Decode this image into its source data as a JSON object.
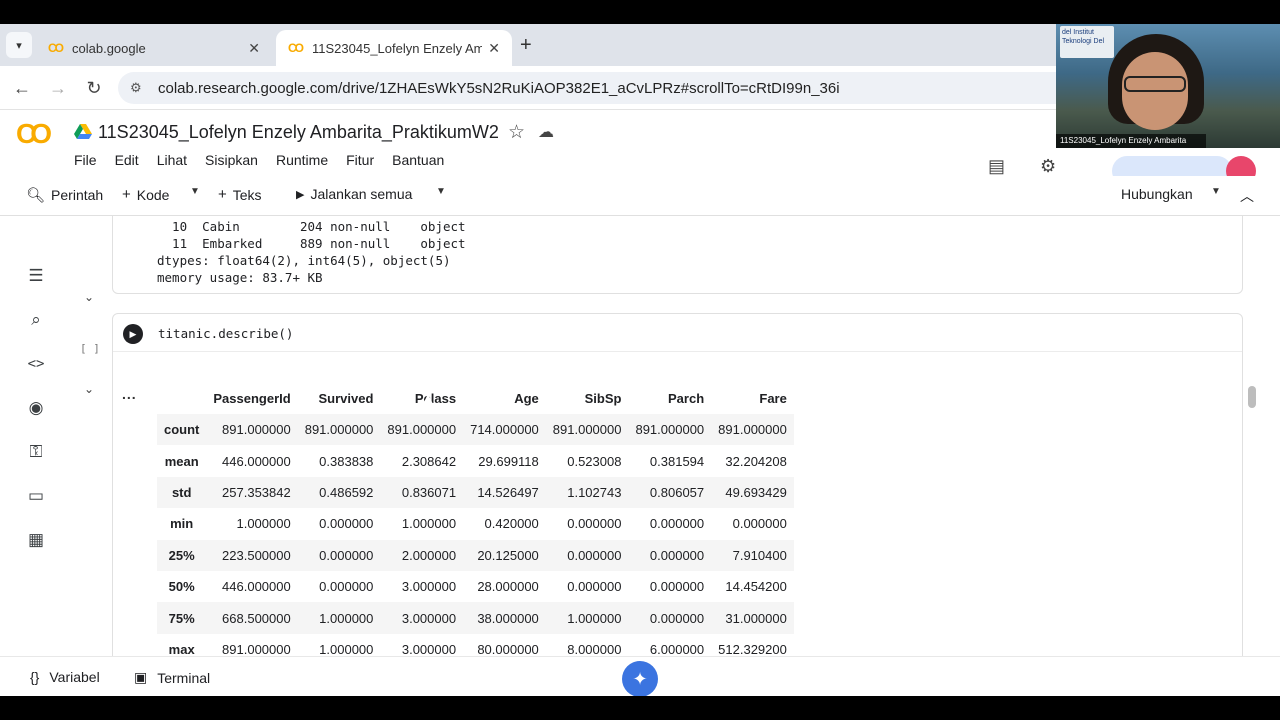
{
  "browser": {
    "tabs": [
      {
        "title": "colab.google",
        "logo": "CO"
      },
      {
        "title": "11S23045_Lofelyn Enzely Amba",
        "logo": "CO"
      }
    ],
    "url": "colab.research.google.com/drive/1ZHAEsWkY5sN2RuKiAOP382E1_aCvLPRz#scrollTo=cRtDI99n_36i"
  },
  "colab": {
    "logo": "CO",
    "notebook_title": "11S23045_Lofelyn Enzely Ambarita_PraktikumW2",
    "menu": [
      "File",
      "Edit",
      "Lihat",
      "Sisipkan",
      "Runtime",
      "Fitur",
      "Bantuan"
    ],
    "toolbar": {
      "command": "Perintah",
      "code": "Kode",
      "text": "Teks",
      "run_all": "Jalankan semua",
      "connect": "Hubungkan"
    }
  },
  "webcam": {
    "caption": "11S23045_Lofelyn Enzely Ambarita",
    "badge": "del Institut Teknologi Del"
  },
  "prev_output": {
    "lines": [
      "  10  Cabin        204 non-null    object",
      "  11  Embarked     889 non-null    object",
      "dtypes: float64(2), int64(5), object(5)",
      "memory usage: 83.7+ KB"
    ]
  },
  "cell": {
    "brackets": "[ ]",
    "code": "titanic.describe()",
    "output_marker": "..."
  },
  "describe_table": {
    "columns": [
      "",
      "PassengerId",
      "Survived",
      "Pclass",
      "Age",
      "SibSp",
      "Parch",
      "Fare"
    ],
    "rows": [
      [
        "count",
        "891.000000",
        "891.000000",
        "891.000000",
        "714.000000",
        "891.000000",
        "891.000000",
        "891.000000"
      ],
      [
        "mean",
        "446.000000",
        "0.383838",
        "2.308642",
        "29.699118",
        "0.523008",
        "0.381594",
        "32.204208"
      ],
      [
        "std",
        "257.353842",
        "0.486592",
        "0.836071",
        "14.526497",
        "1.102743",
        "0.806057",
        "49.693429"
      ],
      [
        "min",
        "1.000000",
        "0.000000",
        "1.000000",
        "0.420000",
        "0.000000",
        "0.000000",
        "0.000000"
      ],
      [
        "25%",
        "223.500000",
        "0.000000",
        "2.000000",
        "20.125000",
        "0.000000",
        "0.000000",
        "7.910400"
      ],
      [
        "50%",
        "446.000000",
        "0.000000",
        "3.000000",
        "28.000000",
        "0.000000",
        "0.000000",
        "14.454200"
      ],
      [
        "75%",
        "668.500000",
        "1.000000",
        "3.000000",
        "38.000000",
        "1.000000",
        "0.000000",
        "31.000000"
      ],
      [
        "max",
        "891.000000",
        "1.000000",
        "3.000000",
        "80.000000",
        "8.000000",
        "6.000000",
        "512.329200"
      ]
    ]
  },
  "bottom": {
    "variables": "Variabel",
    "terminal": "Terminal"
  }
}
